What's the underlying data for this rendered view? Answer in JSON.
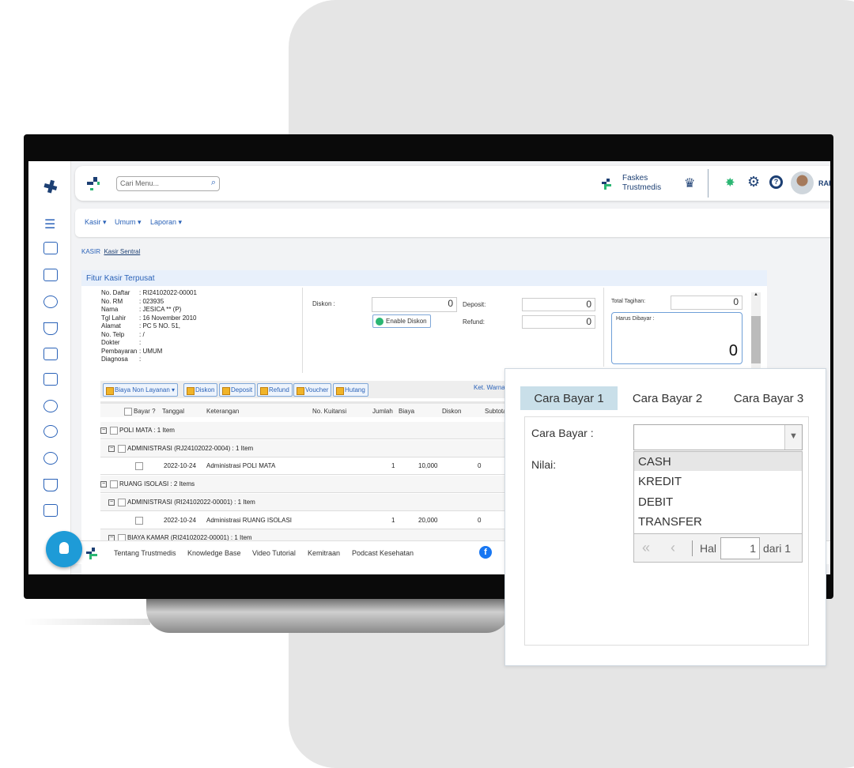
{
  "header": {
    "search_placeholder": "Cari Menu...",
    "faskes_line1": "Faskes",
    "faskes_line2": "Trustmedis",
    "user": "RAH"
  },
  "nav": {
    "items": [
      "Kasir",
      "Umum",
      "Laporan"
    ]
  },
  "breadcrumb": {
    "root": "KASIR",
    "current": "Kasir Sentral"
  },
  "panel": {
    "title": "Fitur Kasir Terpusat",
    "patient": [
      [
        "No. Daftar",
        ": RI24102022-00001"
      ],
      [
        "No. RM",
        ": 023935"
      ],
      [
        "Nama",
        ": JESICA ** (P)"
      ],
      [
        "Tgl Lahir",
        ": 16 November 2010"
      ],
      [
        "Alamat",
        ": PC 5 NO. 51,"
      ],
      [
        "No. Telp",
        ": /"
      ],
      [
        "Dokter",
        ":"
      ],
      [
        "Pembayaran",
        ": UMUM"
      ],
      [
        "Diagnosa",
        ":"
      ]
    ],
    "diskon_label": "Diskon :",
    "diskon_value": "0",
    "enable_diskon": "Enable Diskon",
    "deposit_label": "Deposit:",
    "deposit_value": "0",
    "refund_label": "Refund:",
    "refund_value": "0",
    "total_label": "Total Tagihan:",
    "total_value": "0",
    "harus_label": "Harus Dibayar :",
    "harus_value": "0",
    "ket_warna": "Ket. Warna"
  },
  "toolbar": [
    "Biaya Non Layanan",
    "Diskon",
    "Deposit",
    "Refund",
    "Voucher",
    "Hutang"
  ],
  "table": {
    "headers": [
      "Bayar ?",
      "Tanggal",
      "Keterangan",
      "No. Kuitansi",
      "Jumlah",
      "Biaya",
      "Diskon",
      "Subtotal"
    ],
    "rows": [
      {
        "type": "group",
        "text": "POLI MATA : 1 Item"
      },
      {
        "type": "sub",
        "text": "ADMINISTRASI (RJ24102022-0004) : 1 Item"
      },
      {
        "type": "item",
        "tanggal": "2022-10-24",
        "keterangan": "Administrasi POLI MATA",
        "jumlah": "1",
        "biaya": "10,000",
        "diskon": "0"
      },
      {
        "type": "group",
        "text": "RUANG ISOLASI : 2 Items"
      },
      {
        "type": "sub",
        "text": "ADMINISTRASI (RI24102022-00001) : 1 Item"
      },
      {
        "type": "item",
        "tanggal": "2022-10-24",
        "keterangan": "Administrasi RUANG ISOLASI",
        "jumlah": "1",
        "biaya": "20,000",
        "diskon": "0"
      },
      {
        "type": "sub",
        "text": "BIAYA KAMAR (RI24102022-00001) : 1 Item"
      }
    ]
  },
  "footer": {
    "links": [
      "Tentang Trustmedis",
      "Knowledge Base",
      "Video Tutorial",
      "Kemitraan",
      "Podcast Kesehatan"
    ]
  },
  "popup": {
    "tabs": [
      "Cara Bayar 1",
      "Cara Bayar 2",
      "Cara Bayar 3"
    ],
    "active_tab": 0,
    "cara_bayar_label": "Cara Bayar :",
    "nilai_label": "Nilai:",
    "selected": "",
    "options": [
      "CASH",
      "KREDIT",
      "DEBIT",
      "TRANSFER"
    ],
    "highlighted": "CASH",
    "pager": {
      "hal_label": "Hal",
      "page": "1",
      "of_label": "dari 1"
    }
  },
  "colors": {
    "accent": "#2a62b8",
    "brand_green": "#2bb673",
    "tab_active": "#c9dfe9",
    "background_card": "#e5e5e5"
  }
}
